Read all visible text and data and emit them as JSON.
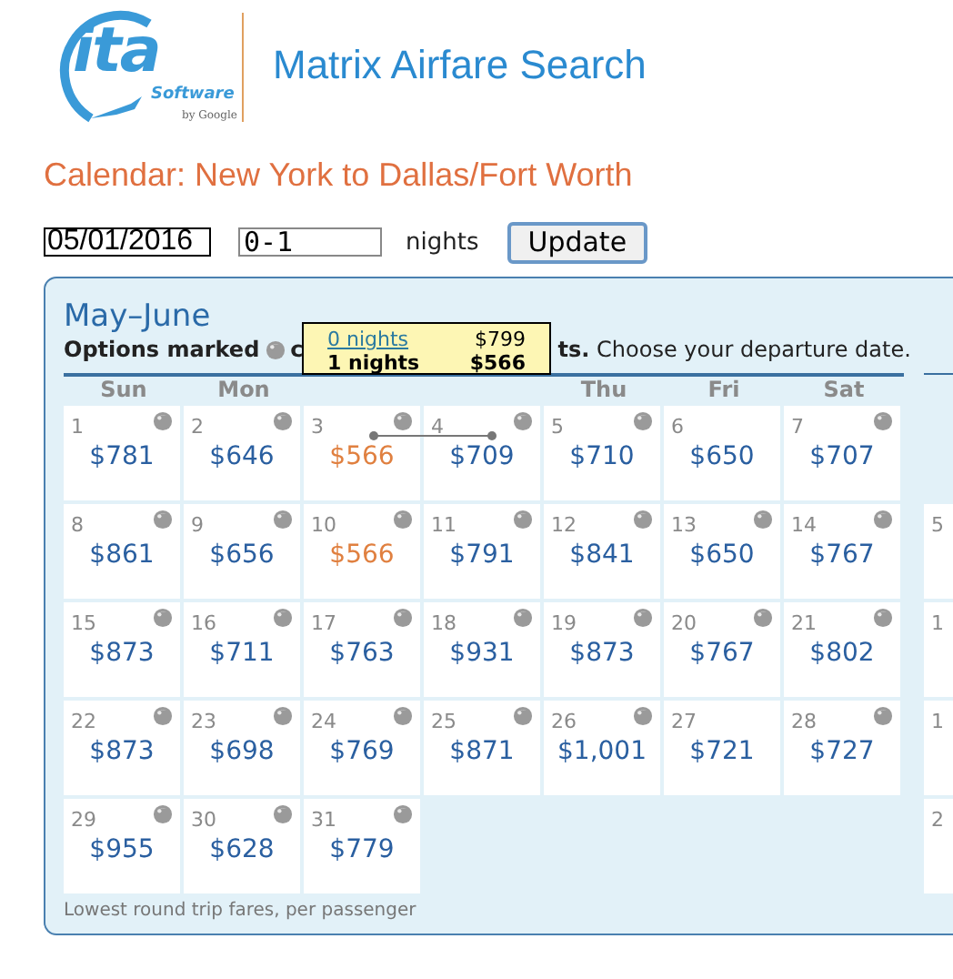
{
  "logo": {
    "name": "ita",
    "tagline": "Software",
    "byline": "by Google"
  },
  "app_title": "Matrix Airfare Search",
  "page_heading": "Calendar: New York to Dallas/Fort Worth",
  "form": {
    "date": "05/01/2016",
    "nights": "0-1",
    "nights_label": "nights",
    "button": "Update"
  },
  "calendar": {
    "title": "May–June",
    "legend": {
      "lead": "Options marked",
      "after_icon": "c",
      "tail": "**ts.** Choose your departure date."
    },
    "weekdays_left": [
      "Sun",
      "Mon"
    ],
    "weekdays_right": [
      "Thu",
      "Fri",
      "Sat"
    ],
    "days": [
      {
        "day": "1",
        "price": "$781",
        "marked": true,
        "lowest": false
      },
      {
        "day": "2",
        "price": "$646",
        "marked": true,
        "lowest": false
      },
      {
        "day": "3",
        "price": "$566",
        "marked": true,
        "lowest": true,
        "trip_start": true
      },
      {
        "day": "4",
        "price": "$709",
        "marked": true,
        "lowest": false,
        "trip_end": true
      },
      {
        "day": "5",
        "price": "$710",
        "marked": true,
        "lowest": false
      },
      {
        "day": "6",
        "price": "$650",
        "marked": false,
        "lowest": false
      },
      {
        "day": "7",
        "price": "$707",
        "marked": true,
        "lowest": false
      },
      {
        "day": "8",
        "price": "$861",
        "marked": true,
        "lowest": false
      },
      {
        "day": "9",
        "price": "$656",
        "marked": true,
        "lowest": false
      },
      {
        "day": "10",
        "price": "$566",
        "marked": true,
        "lowest": true
      },
      {
        "day": "11",
        "price": "$791",
        "marked": true,
        "lowest": false
      },
      {
        "day": "12",
        "price": "$841",
        "marked": true,
        "lowest": false
      },
      {
        "day": "13",
        "price": "$650",
        "marked": true,
        "lowest": false
      },
      {
        "day": "14",
        "price": "$767",
        "marked": true,
        "lowest": false
      },
      {
        "day": "15",
        "price": "$873",
        "marked": true,
        "lowest": false
      },
      {
        "day": "16",
        "price": "$711",
        "marked": true,
        "lowest": false
      },
      {
        "day": "17",
        "price": "$763",
        "marked": true,
        "lowest": false
      },
      {
        "day": "18",
        "price": "$931",
        "marked": true,
        "lowest": false
      },
      {
        "day": "19",
        "price": "$873",
        "marked": true,
        "lowest": false
      },
      {
        "day": "20",
        "price": "$767",
        "marked": true,
        "lowest": false
      },
      {
        "day": "21",
        "price": "$802",
        "marked": true,
        "lowest": false
      },
      {
        "day": "22",
        "price": "$873",
        "marked": true,
        "lowest": false
      },
      {
        "day": "23",
        "price": "$698",
        "marked": true,
        "lowest": false
      },
      {
        "day": "24",
        "price": "$769",
        "marked": true,
        "lowest": false
      },
      {
        "day": "25",
        "price": "$871",
        "marked": true,
        "lowest": false
      },
      {
        "day": "26",
        "price": "$1,001",
        "marked": true,
        "lowest": false
      },
      {
        "day": "27",
        "price": "$721",
        "marked": false,
        "lowest": false
      },
      {
        "day": "28",
        "price": "$727",
        "marked": true,
        "lowest": false
      },
      {
        "day": "29",
        "price": "$955",
        "marked": true,
        "lowest": false
      },
      {
        "day": "30",
        "price": "$628",
        "marked": true,
        "lowest": false
      },
      {
        "day": "31",
        "price": "$779",
        "marked": true,
        "lowest": false
      }
    ],
    "next_month_days": [
      "5",
      "1",
      "1",
      "2"
    ],
    "footnote": "Lowest round trip fares, per passenger",
    "tooltip": {
      "rows": [
        {
          "nights": "0 nights",
          "price": "$799",
          "selected": false
        },
        {
          "nights": "1 nights",
          "price": "$566",
          "selected": true
        }
      ]
    }
  }
}
